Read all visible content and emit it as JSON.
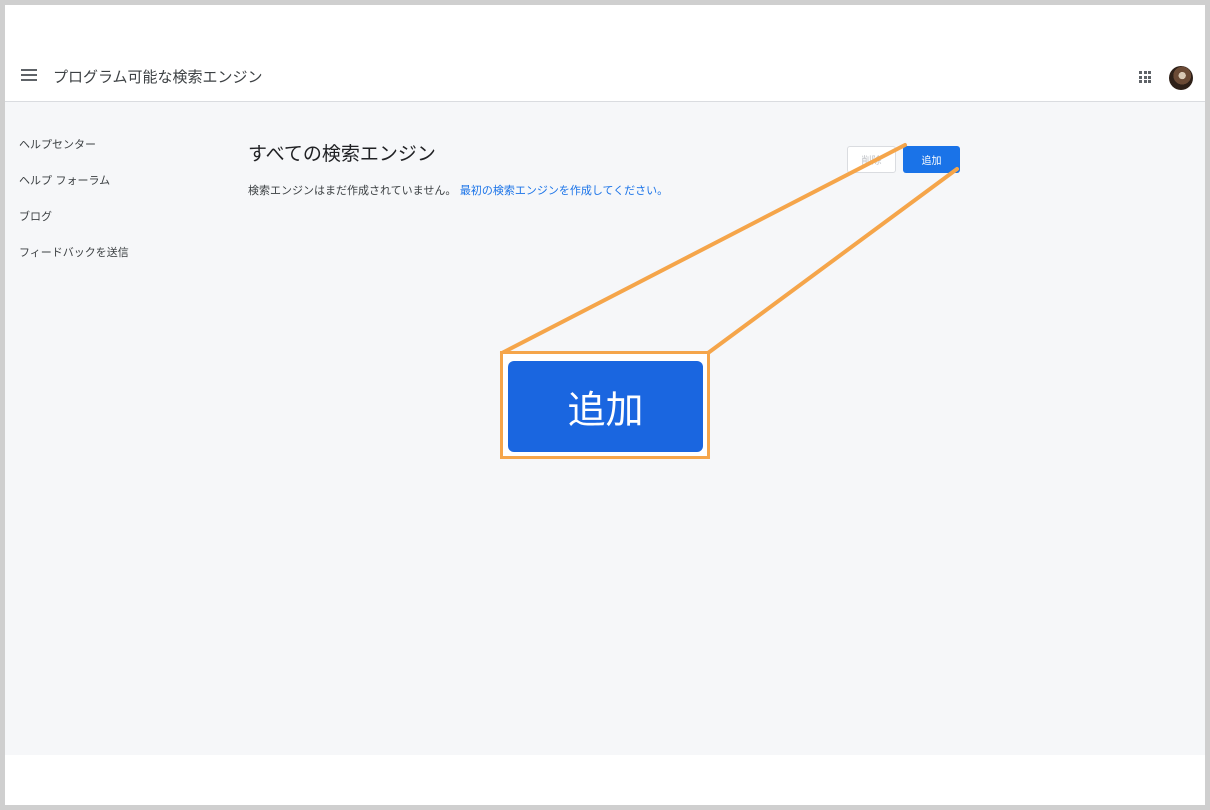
{
  "header": {
    "title": "プログラム可能な検索エンジン",
    "menu_icon": "menu-icon",
    "apps_icon": "apps-grid-icon"
  },
  "sidebar": {
    "items": [
      {
        "label": "ヘルプセンター"
      },
      {
        "label": "ヘルプ フォーラム"
      },
      {
        "label": "ブログ"
      },
      {
        "label": "フィードバックを送信"
      }
    ]
  },
  "main": {
    "title": "すべての検索エンジン",
    "empty_message": "検索エンジンはまだ作成されていません。",
    "create_link": "最初の検索エンジンを作成してください。",
    "delete_label": "削除",
    "add_label": "追加"
  },
  "callout": {
    "label": "追加",
    "border_color": "#f5a54a"
  },
  "colors": {
    "accent": "#1a73e8",
    "content_bg": "#f6f7f9",
    "highlight": "#f5a54a"
  }
}
